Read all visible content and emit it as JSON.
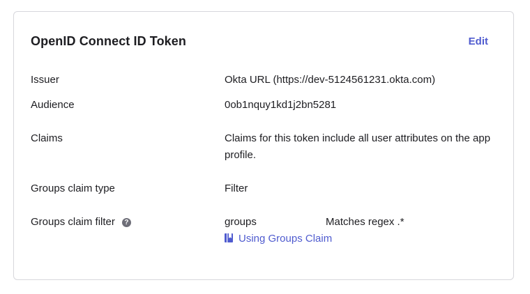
{
  "card": {
    "title": "OpenID Connect ID Token",
    "edit_label": "Edit"
  },
  "rows": [
    {
      "label": "Issuer",
      "value": "Okta URL (https://dev-5124561231.okta.com)"
    },
    {
      "label": "Audience",
      "value": "0ob1nquy1kd1j2bn5281"
    },
    {
      "label": "Claims",
      "value": "Claims for this token include all user attributes on the app profile."
    },
    {
      "label": "Groups claim type",
      "value": "Filter"
    },
    {
      "label": "Groups claim filter",
      "value": "groups"
    }
  ],
  "groups_filter": {
    "match_type": "Matches regex",
    "regex": ".*",
    "match_display": "Matches regex .*",
    "help_icon": "question-circle-icon",
    "doc_link_icon": "book-icon",
    "doc_link_label": "Using Groups Claim"
  },
  "colors": {
    "link": "#4f5bcf",
    "border": "#d7d7dc",
    "text": "#1d1d21",
    "help_icon": "#6e6e78"
  }
}
